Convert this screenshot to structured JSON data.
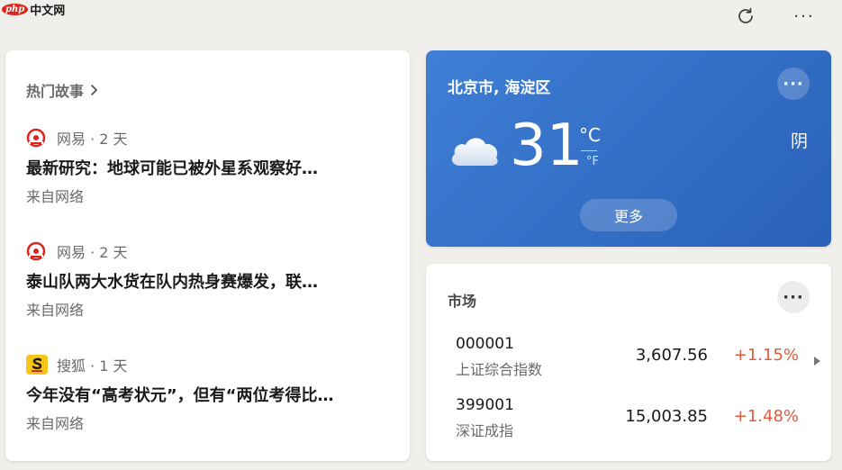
{
  "header": {
    "logo_badge": "php",
    "logo_text": "中文网",
    "refresh_icon": "refresh-icon",
    "more_label": "···"
  },
  "news": {
    "title": "热门故事",
    "items": [
      {
        "source": "网易",
        "age": "2 天",
        "headline": "最新研究：地球可能已被外星系观察好…",
        "from": "来自网络",
        "icon": "netease-icon",
        "icon_color": "#d9271e"
      },
      {
        "source": "网易",
        "age": "2 天",
        "headline": "泰山队两大水货在队内热身赛爆发，联…",
        "from": "来自网络",
        "icon": "netease-icon",
        "icon_color": "#d9271e"
      },
      {
        "source": "搜狐",
        "age": "1 天",
        "headline": "今年没有“高考状元”，但有“两位考得比…",
        "from": "来自网络",
        "icon": "sohu-icon",
        "icon_color": "#f5c518"
      }
    ]
  },
  "weather": {
    "location": "北京市, 海淀区",
    "more_dots": "···",
    "temperature": "31",
    "unit_c": "°C",
    "unit_f": "°F",
    "condition": "阴",
    "more_label": "更多",
    "card_color": "#2f6cc4"
  },
  "market": {
    "title": "市场",
    "more_dots": "···",
    "rows": [
      {
        "code": "000001",
        "name": "上证综合指数",
        "value": "3,607.56",
        "change": "+1.15%"
      },
      {
        "code": "399001",
        "name": "深证成指",
        "value": "15,003.85",
        "change": "+1.48%"
      }
    ],
    "change_color": "#e25a3c"
  }
}
